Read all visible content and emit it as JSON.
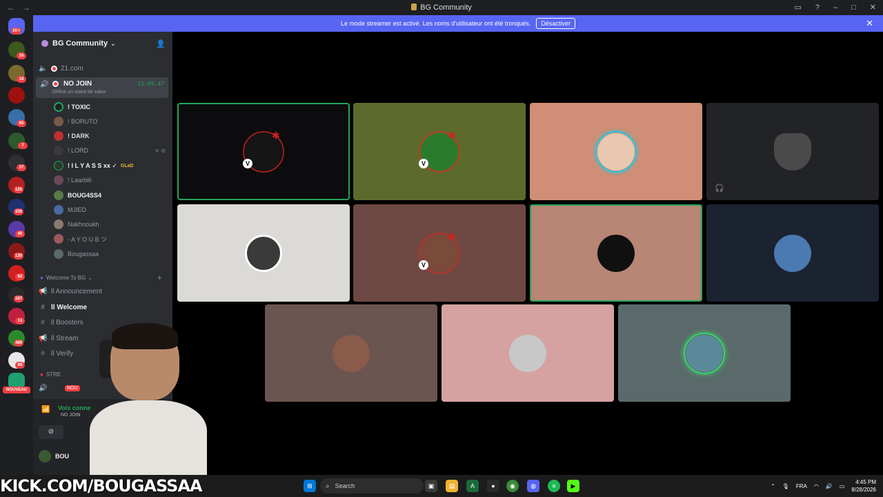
{
  "window": {
    "title": "BG Community"
  },
  "banner": {
    "text": "Le mode streamer est activé. Les noms d'utilisateur ont été tronqués.",
    "button": "Désactiver"
  },
  "rail": {
    "badges": [
      "1K+",
      "16",
      "18",
      "65",
      "7",
      "37",
      "125",
      "339",
      "40",
      "130",
      "62",
      "167",
      "13",
      "489",
      "88"
    ],
    "new_label": "NOUVEAU"
  },
  "server": {
    "name": "BG Community"
  },
  "channels": {
    "c1": "21.com",
    "active_name": "NO JOIN",
    "active_time": "11:05:47",
    "active_status": "Définir un statut de salon",
    "users": [
      {
        "name": "! TOXIC",
        "bold": true
      },
      {
        "name": "! BORUTO",
        "bold": false
      },
      {
        "name": "! DARK",
        "bold": true
      },
      {
        "name": "! LORD",
        "bold": false
      },
      {
        "name": "! I L Y A S S xx ✓",
        "bold": true,
        "tag": "GLaD"
      },
      {
        "name": "! Laarbili·",
        "bold": false
      },
      {
        "name": "BOUG4SS4",
        "bold": true
      },
      {
        "name": "MJIED",
        "bold": false
      },
      {
        "name": "Nakhnoukh",
        "bold": false
      },
      {
        "name": "- A Y O U B ツ",
        "bold": false
      },
      {
        "name": "Bougassaa",
        "bold": false
      }
    ],
    "category": "Welcome To BG",
    "text_channels": [
      {
        "name": "ll Announcement",
        "icon": "🔊"
      },
      {
        "name": "ll Welcome",
        "icon": "#"
      },
      {
        "name": "ll Boosters",
        "icon": "#"
      },
      {
        "name": "ll Stream",
        "icon": "🔊"
      },
      {
        "name": "ll Verify",
        "icon": "#"
      }
    ],
    "cat2": "STRE",
    "new_badge": "NOU"
  },
  "voice_panel": {
    "label": "Voix conne",
    "sub": "NO JOIN",
    "user": "BOU"
  },
  "tiles_colors": {
    "t1": "#0c0c0e",
    "t2": "#5c6b2c",
    "t3": "#d08e76",
    "t4": "#222326",
    "t5": "#dcdad6",
    "t6": "#6e4842",
    "t7": "#b98574",
    "t8": "#1b2230",
    "t9": "#6b5550",
    "t10": "#d6a1a1",
    "t11": "#5a6a6a"
  },
  "taskbar": {
    "overlay": "KICK.COM/BOUGASSAA",
    "search": "Search",
    "lang": "FRA",
    "time": "4:45 PM",
    "date": "8/28/2026"
  }
}
